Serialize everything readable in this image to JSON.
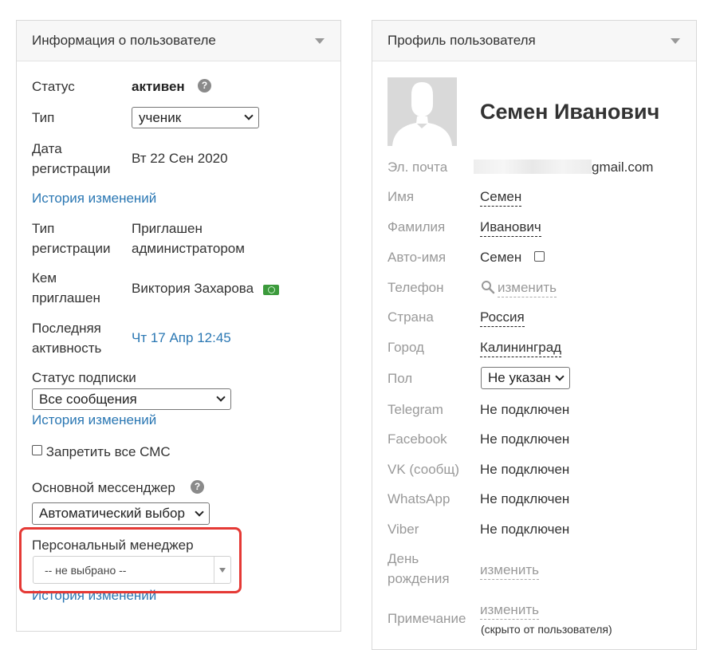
{
  "user_info": {
    "title": "Информация о пользователе",
    "status_label": "Статус",
    "status_value": "активен",
    "type_label": "Тип",
    "type_value": "ученик",
    "reg_date_label_1": "Дата",
    "reg_date_label_2": "регистрации",
    "reg_date_value": "Вт 22 Сен 2020",
    "history_link": "История изменений",
    "reg_type_label_1": "Тип",
    "reg_type_label_2": "регистрации",
    "reg_type_value_1": "Приглашен",
    "reg_type_value_2": "администратором",
    "invited_label_1": "Кем",
    "invited_label_2": "приглашен",
    "invited_value": "Виктория Захарова",
    "last_activity_label_1": "Последняя",
    "last_activity_label_2": "активность",
    "last_activity_value": "Чт 17 Апр 12:45",
    "subscription_label": "Статус подписки",
    "subscription_value": "Все сообщения",
    "subscription_history": "История изменений",
    "forbid_sms_label": "Запретить все СМС",
    "messenger_label": "Основной мессенджер",
    "messenger_value": "Автоматический выбор",
    "manager_label": "Персональный менеджер",
    "manager_value": "-- не выбрано --",
    "manager_history": "История изменений"
  },
  "profile": {
    "title": "Профиль пользователя",
    "name": "Семен Иванович",
    "email_label": "Эл. почта",
    "email_visible": "gmail.com",
    "first_name_label": "Имя",
    "first_name_value": "Семен",
    "last_name_label": "Фамилия",
    "last_name_value": "Иванович",
    "auto_name_label": "Авто-имя",
    "auto_name_value": "Семен",
    "phone_label": "Телефон",
    "phone_action": "изменить",
    "country_label": "Страна",
    "country_value": "Россия",
    "city_label": "Город",
    "city_value": "Калининград",
    "gender_label": "Пол",
    "gender_value": "Не указан",
    "telegram_label": "Telegram",
    "telegram_value": "Не подключен",
    "facebook_label": "Facebook",
    "facebook_value": "Не подключен",
    "vk_label": "VK (сообщ)",
    "vk_value": "Не подключен",
    "whatsapp_label": "WhatsApp",
    "whatsapp_value": "Не подключен",
    "viber_label": "Viber",
    "viber_value": "Не подключен",
    "birthday_label_1": "День",
    "birthday_label_2": "рождения",
    "birthday_action": "изменить",
    "note_label": "Примечание",
    "note_action": "изменить",
    "note_hint": "(скрыто от пользователя)"
  },
  "icons": {
    "help": "question-circle-icon",
    "money": "cash-icon",
    "search": "magnifier-icon",
    "collapse": "caret-down-icon"
  },
  "colors": {
    "link": "#2a77b3",
    "highlight": "#e53935",
    "muted": "#999999"
  }
}
